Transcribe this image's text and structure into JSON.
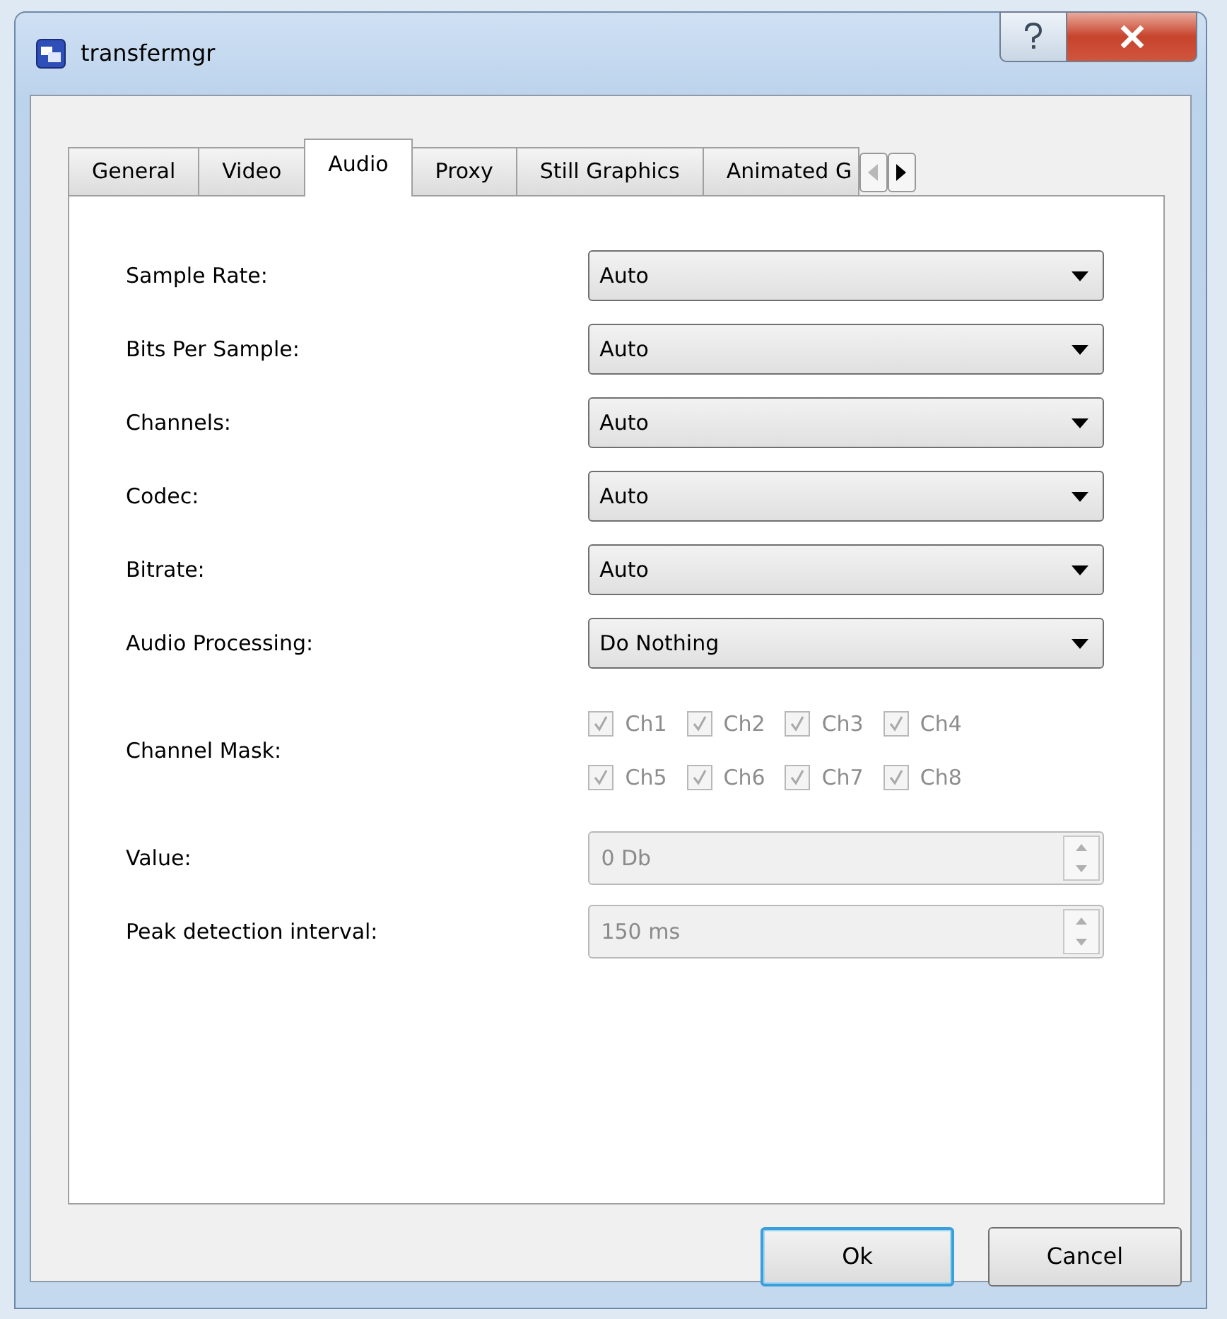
{
  "window": {
    "title": "transfermgr"
  },
  "tabs": [
    {
      "label": "General",
      "selected": false
    },
    {
      "label": "Video",
      "selected": false
    },
    {
      "label": "Audio",
      "selected": true
    },
    {
      "label": "Proxy",
      "selected": false
    },
    {
      "label": "Still Graphics",
      "selected": false
    },
    {
      "label": "Animated G",
      "selected": false
    }
  ],
  "fields": [
    {
      "kind": "dropdown",
      "label": "Sample Rate:",
      "value": "Auto",
      "disabled": false
    },
    {
      "kind": "dropdown",
      "label": "Bits Per Sample:",
      "value": "Auto",
      "disabled": false
    },
    {
      "kind": "dropdown",
      "label": "Channels:",
      "value": "Auto",
      "disabled": false
    },
    {
      "kind": "dropdown",
      "label": "Codec:",
      "value": "Auto",
      "disabled": false
    },
    {
      "kind": "dropdown",
      "label": "Bitrate:",
      "value": "Auto",
      "disabled": false
    },
    {
      "kind": "dropdown",
      "label": "Audio Processing:",
      "value": "Do Nothing",
      "disabled": false
    },
    {
      "kind": "checkgroup",
      "label": "Channel Mask:",
      "disabled": true,
      "options": [
        {
          "label": "Ch1",
          "checked": true
        },
        {
          "label": "Ch2",
          "checked": true
        },
        {
          "label": "Ch3",
          "checked": true
        },
        {
          "label": "Ch4",
          "checked": true
        },
        {
          "label": "Ch5",
          "checked": true
        },
        {
          "label": "Ch6",
          "checked": true
        },
        {
          "label": "Ch7",
          "checked": true
        },
        {
          "label": "Ch8",
          "checked": true
        }
      ]
    },
    {
      "kind": "spin",
      "label": "Value:",
      "value": "0 Db",
      "disabled": true
    },
    {
      "kind": "spin",
      "label": "Peak detection interval:",
      "value": "150 ms",
      "disabled": true
    }
  ],
  "buttons": [
    {
      "label": "Ok",
      "default": true
    },
    {
      "label": "Cancel",
      "default": false
    }
  ]
}
